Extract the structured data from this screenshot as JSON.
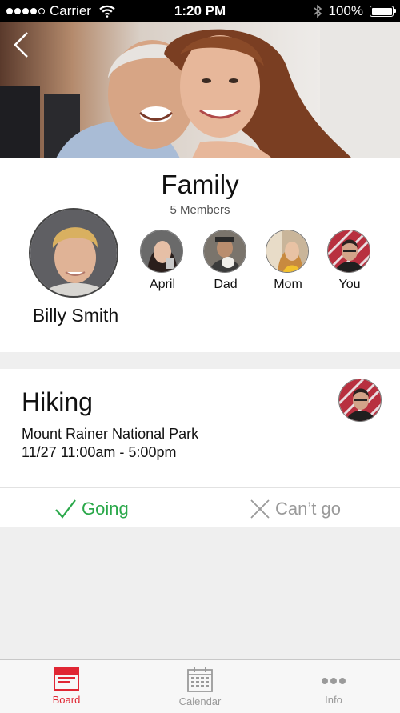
{
  "status_bar": {
    "carrier": "Carrier",
    "time": "1:20 PM",
    "battery": "100%",
    "battery_level": 1.0,
    "signal_dots": 5,
    "signal_filled": 4
  },
  "header": {
    "back_icon": "chevron-left-icon"
  },
  "group": {
    "title": "Family",
    "members_count": "5 Members",
    "main_member": {
      "name": "Billy Smith"
    },
    "members": [
      {
        "name": "April"
      },
      {
        "name": "Dad"
      },
      {
        "name": "Mom"
      },
      {
        "name": "You"
      }
    ]
  },
  "event": {
    "title": "Hiking",
    "location": "Mount Rainer National Park",
    "time": "11/27 11:00am - 5:00pm",
    "going_label": "Going",
    "cant_go_label": "Can’t go"
  },
  "tab_bar": {
    "tabs": [
      {
        "label": "Board",
        "icon": "board-icon",
        "active": true
      },
      {
        "label": "Calendar",
        "icon": "calendar-icon",
        "active": false
      },
      {
        "label": "Info",
        "icon": "more-icon",
        "active": false
      }
    ]
  },
  "colors": {
    "accent": "#e02633",
    "going": "#2aa84a",
    "muted": "#9a9a9a"
  }
}
